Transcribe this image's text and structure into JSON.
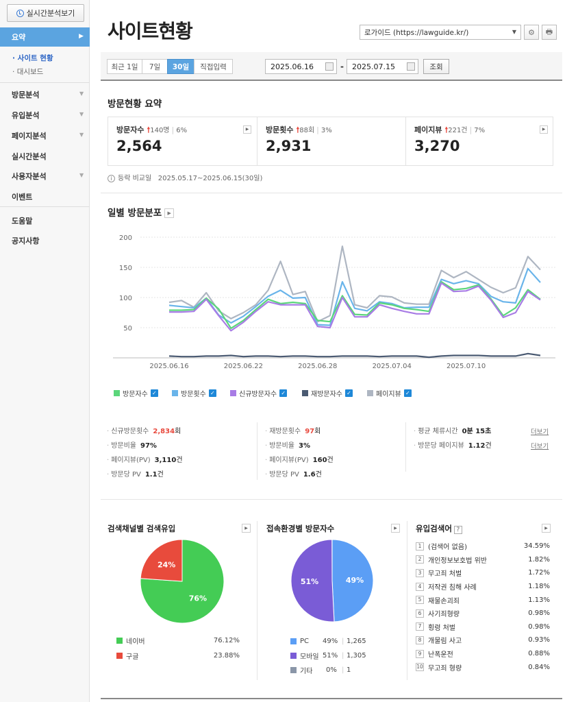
{
  "sidebar": {
    "realtime_button": "실시간분석보기",
    "summary_label": "요약",
    "sub_items": [
      "사이트 현황",
      "대시보드"
    ],
    "items": [
      "방문분석",
      "유입분석",
      "페이지분석",
      "실시간분석",
      "사용자분석",
      "이벤트",
      "도움말",
      "공지사항"
    ]
  },
  "header": {
    "title": "사이트현황",
    "site_select": "로가이드 (https://lawguide.kr/)"
  },
  "date_bar": {
    "ranges": [
      "최근 1일",
      "7일",
      "30일",
      "직접입력"
    ],
    "selected_range": "30일",
    "start_date": "2025.06.16",
    "separator": "-",
    "end_date": "2025.07.15",
    "search_button": "조회"
  },
  "summary": {
    "title": "방문현황 요약",
    "kpis": [
      {
        "label": "방문자수",
        "delta": "140명",
        "pct": "6%",
        "value": "2,564"
      },
      {
        "label": "방문횟수",
        "delta": "88회",
        "pct": "3%",
        "value": "2,931"
      },
      {
        "label": "페이지뷰",
        "delta": "221건",
        "pct": "7%",
        "value": "3,270"
      }
    ],
    "compare_label": "등락 비교일",
    "compare_range": "2025.05.17~2025.06.15(30일)"
  },
  "daily": {
    "title": "일별 방문분포"
  },
  "chart_data": {
    "type": "line",
    "ylim": [
      0,
      200
    ],
    "yticks": [
      50,
      100,
      150,
      200
    ],
    "xtick_labels": [
      "2025.06.16",
      "2025.06.22",
      "2025.06.28",
      "2025.07.04",
      "2025.07.10"
    ],
    "xtick_index": [
      0,
      6,
      12,
      18,
      24
    ],
    "n_points": 30,
    "series": [
      {
        "name": "방문자수",
        "color": "#5bd67b",
        "values": [
          79,
          79,
          80,
          99,
          81,
          49,
          62,
          80,
          97,
          90,
          92,
          90,
          62,
          60,
          103,
          72,
          71,
          91,
          88,
          82,
          80,
          77,
          126,
          113,
          115,
          121,
          98,
          70,
          83,
          113,
          97
        ]
      },
      {
        "name": "방문횟수",
        "color": "#69b4ea",
        "values": [
          87,
          85,
          83,
          99,
          71,
          58,
          69,
          85,
          102,
          112,
          99,
          100,
          55,
          54,
          126,
          82,
          78,
          93,
          90,
          83,
          84,
          84,
          130,
          123,
          128,
          123,
          102,
          93,
          91,
          148,
          125
        ]
      },
      {
        "name": "신규방문자수",
        "color": "#a87ce5",
        "values": [
          76,
          76,
          77,
          97,
          70,
          45,
          59,
          77,
          93,
          88,
          88,
          88,
          52,
          50,
          100,
          68,
          68,
          88,
          82,
          77,
          73,
          73,
          124,
          110,
          111,
          119,
          96,
          67,
          75,
          110,
          96
        ]
      },
      {
        "name": "재방문자수",
        "color": "#4a5a72",
        "values": [
          3,
          2,
          2,
          3,
          3,
          4,
          2,
          3,
          3,
          2,
          3,
          3,
          2,
          2,
          3,
          3,
          3,
          2,
          3,
          3,
          3,
          1,
          3,
          4,
          4,
          4,
          3,
          3,
          3,
          7,
          4
        ]
      },
      {
        "name": "페이지뷰",
        "color": "#aeb6c2",
        "values": [
          92,
          95,
          84,
          108,
          78,
          65,
          75,
          88,
          112,
          160,
          105,
          110,
          60,
          70,
          185,
          88,
          83,
          103,
          101,
          91,
          89,
          89,
          145,
          133,
          143,
          130,
          117,
          108,
          116,
          168,
          146
        ]
      }
    ]
  },
  "stats": {
    "col1": [
      {
        "label": "신규방문횟수",
        "value": "2,834",
        "unit": "회"
      },
      {
        "label": "방문비율",
        "value": "97%",
        "unit": ""
      },
      {
        "label": "페이지뷰(PV)",
        "value": "3,110",
        "unit": "건"
      },
      {
        "label": "방문당 PV",
        "value": "1.1",
        "unit": "건"
      }
    ],
    "col2": [
      {
        "label": "재방문횟수",
        "value": "97",
        "unit": "회"
      },
      {
        "label": "방문비율",
        "value": "3%",
        "unit": ""
      },
      {
        "label": "페이지뷰(PV)",
        "value": "160",
        "unit": "건"
      },
      {
        "label": "방문당 PV",
        "value": "1.6",
        "unit": "건"
      }
    ],
    "col3": [
      {
        "label": "평균 체류시간",
        "value": "0분 15초",
        "unit": ""
      },
      {
        "label": "방문당 페이지뷰",
        "value": "1.12",
        "unit": "건"
      }
    ],
    "more": "더보기"
  },
  "search_channel": {
    "title": "검색채널별 검색유입",
    "slices": [
      {
        "name": "네이버",
        "pct": "76.12%",
        "label": "76%",
        "value": 76.12,
        "color": "#44cc55"
      },
      {
        "name": "구글",
        "pct": "23.88%",
        "label": "24%",
        "value": 23.88,
        "color": "#e84b3c"
      }
    ]
  },
  "env": {
    "title": "접속환경별 방문자수",
    "slices": [
      {
        "name": "PC",
        "pct": "49%",
        "count": "1,265",
        "label": "49%",
        "value": 1265,
        "color": "#5b9ef5"
      },
      {
        "name": "모바일",
        "pct": "51%",
        "count": "1,305",
        "label": "51%",
        "value": 1305,
        "color": "#7a5cd6"
      },
      {
        "name": "기타",
        "pct": "0%",
        "count": "1",
        "label": "",
        "value": 1,
        "color": "#8a96a8"
      }
    ]
  },
  "keywords": {
    "title": "유입검색어",
    "help": "?",
    "items": [
      {
        "rank": "1",
        "keyword": "(검색어 없음)",
        "pct": "34.59%"
      },
      {
        "rank": "2",
        "keyword": "개인정보보호법 위반",
        "pct": "1.82%"
      },
      {
        "rank": "3",
        "keyword": "무고죄 처벌",
        "pct": "1.72%"
      },
      {
        "rank": "4",
        "keyword": "저작권 침해 사례",
        "pct": "1.18%"
      },
      {
        "rank": "5",
        "keyword": "재물손괴죄",
        "pct": "1.13%"
      },
      {
        "rank": "6",
        "keyword": "사기죄형량",
        "pct": "0.98%"
      },
      {
        "rank": "7",
        "keyword": "횡령 처벌",
        "pct": "0.98%"
      },
      {
        "rank": "8",
        "keyword": "개물림 사고",
        "pct": "0.93%"
      },
      {
        "rank": "9",
        "keyword": "난폭운전",
        "pct": "0.88%"
      },
      {
        "rank": "10",
        "keyword": "무고죄 형량",
        "pct": "0.84%"
      }
    ]
  }
}
